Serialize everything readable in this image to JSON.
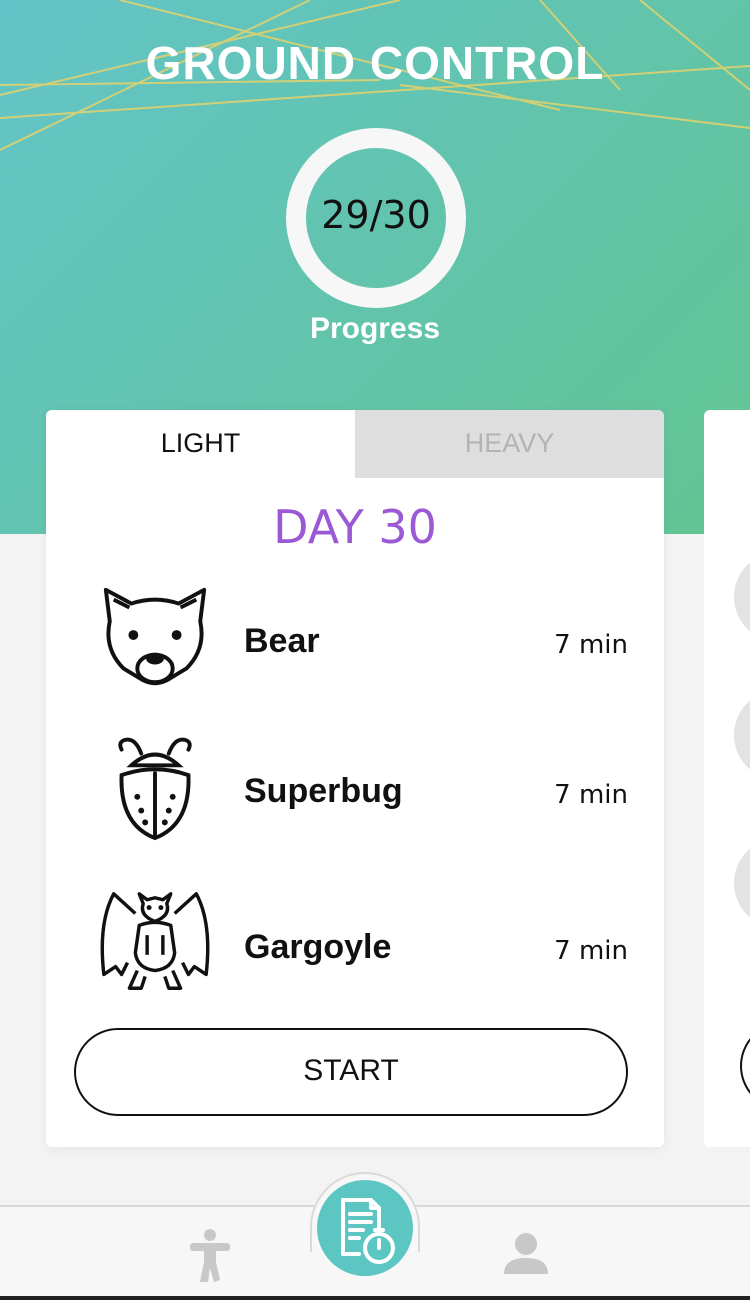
{
  "app": {
    "title": "GROUND CONTROL"
  },
  "progress": {
    "display": "29/30",
    "label": "Progress",
    "completed": 29,
    "total": 30
  },
  "card": {
    "tabs": [
      {
        "label": "LIGHT",
        "active": true
      },
      {
        "label": "HEAVY",
        "active": false
      }
    ],
    "day_title": "DAY 30",
    "exercises": [
      {
        "name": "Bear",
        "duration": "7 min",
        "icon": "bear-icon"
      },
      {
        "name": "Superbug",
        "duration": "7 min",
        "icon": "bug-icon"
      },
      {
        "name": "Gargoyle",
        "duration": "7 min",
        "icon": "gargoyle-icon"
      }
    ],
    "start_label": "START"
  },
  "nav": {
    "items": [
      {
        "icon": "exercise-figure-icon"
      },
      {
        "icon": "workout-timer-icon",
        "active": true
      },
      {
        "icon": "profile-icon"
      }
    ]
  },
  "colors": {
    "hero_gradient_start": "#63c4c8",
    "hero_gradient_end": "#63c593",
    "day_title": "#9b59d6",
    "nav_active": "#5cc6c2",
    "inactive_tab": "#dedede"
  }
}
